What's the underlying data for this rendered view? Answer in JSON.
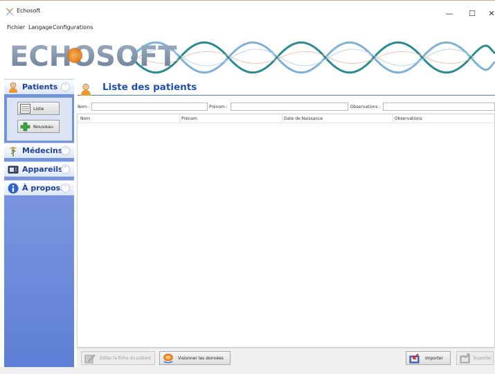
{
  "window": {
    "title": "Echosoft",
    "controls": {
      "minimize": "—",
      "maximize": "☐",
      "close": "✕"
    }
  },
  "menu": [
    "Fichier",
    "Langage",
    "Configurations"
  ],
  "banner": {
    "logo_text": "ECHOSOFT"
  },
  "sidebar": {
    "sections": [
      {
        "label": "Patients",
        "icon": "patient-icon",
        "toggle": "˄",
        "expanded": true
      },
      {
        "label": "Médecins",
        "icon": "caduceus-icon",
        "toggle": "˅",
        "expanded": false
      },
      {
        "label": "Appareils",
        "icon": "device-icon",
        "toggle": "˅",
        "expanded": false
      },
      {
        "label": "À propos...",
        "icon": "info-icon",
        "toggle": "˅",
        "expanded": false
      }
    ],
    "patients_buttons": [
      {
        "label": "Liste",
        "icon": "list-icon"
      },
      {
        "label": "Nouveau",
        "icon": "plus-icon"
      }
    ]
  },
  "main": {
    "title": "Liste des patients",
    "filters": [
      {
        "label": "Nom :",
        "value": ""
      },
      {
        "label": "Prénom :",
        "value": ""
      },
      {
        "label": "Observations :",
        "value": ""
      }
    ],
    "table": {
      "columns": [
        "Nom",
        "Prénom",
        "Date de Naissance",
        "Observations"
      ],
      "rows": []
    }
  },
  "toolbar": {
    "edit_label": "Editer la fiche du patient",
    "view_label": "Visionner les données",
    "import_label": "Importer",
    "export_label": "Exporter"
  },
  "colors": {
    "accent": "#1f4fb4",
    "sidebar": "#6f8fdc",
    "header_line": "#4a78c8"
  }
}
